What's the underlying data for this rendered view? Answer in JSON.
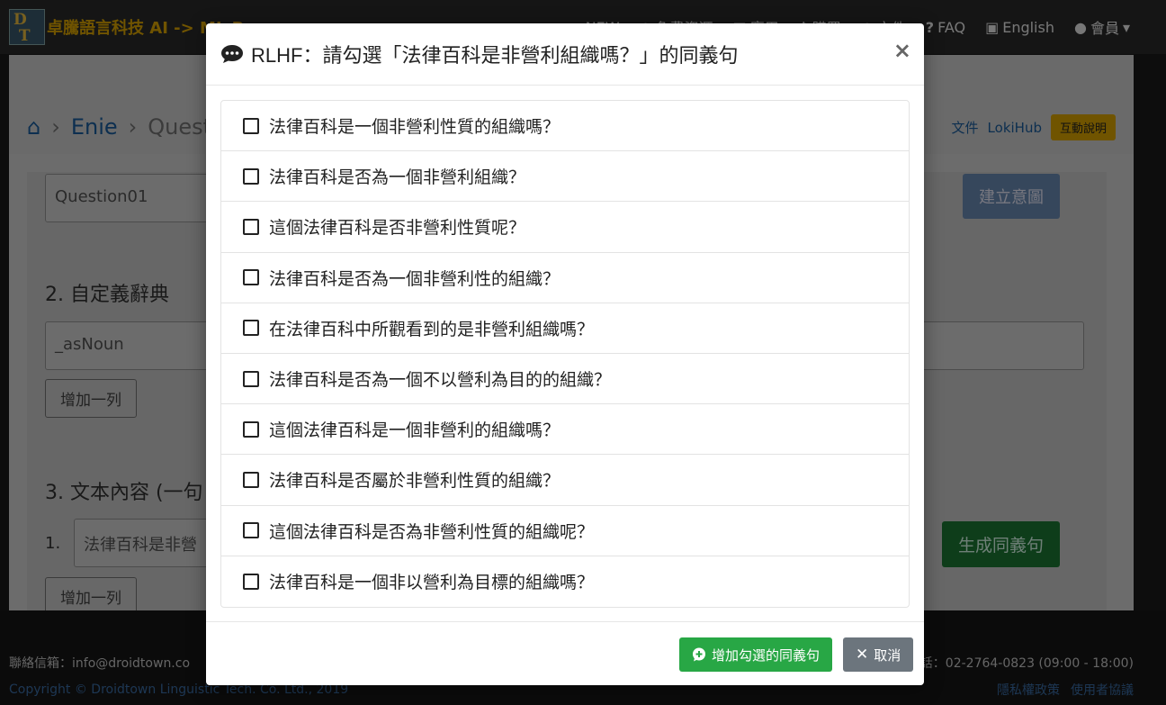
{
  "navbar": {
    "brand": "卓騰語言科技 AI -> ML B",
    "links": [
      "NEW",
      "免費資源",
      "應用",
      "購買",
      "文件",
      "FAQ",
      "English",
      "會員"
    ]
  },
  "background": {
    "breadcrumb": [
      "Enie",
      "Quest"
    ],
    "top_links": [
      "文件",
      "LokiHub",
      "互動說明"
    ],
    "intent_input": "Question01",
    "create_intent_button": "建立意圖",
    "section2": "2. 自定義辭典",
    "dict_input": "_asNoun",
    "add_row": "增加一列",
    "section3": "3. 文本內容 (一句",
    "row_number": "1.",
    "sentence_input": "法律百科是非營",
    "generate_button": "生成同義句",
    "add_row2": "增加一列"
  },
  "footer": {
    "mail": "聯絡信箱：info@droidtown.co",
    "copyright": "Copyright © Droidtown Linguistic Tech. Co. Ltd., 2019",
    "phone": "話：02-2764-0823 (09:00 - 18:00)",
    "privacy": "隱私權政策",
    "terms": "使用者協議"
  },
  "modal": {
    "title": "RLHF：請勾選「法律百科是非營利組織嗎？」的同義句",
    "close": "×",
    "options": [
      "法律百科是一個非營利性質的組織嗎？",
      "法律百科是否為一個非營利組織？",
      "這個法律百科是否非營利性質呢？",
      "法律百科是否為一個非營利性的組織？",
      "在法律百科中所觀看到的是非營利組織嗎？",
      "法律百科是否為一個不以營利為目的的組織？",
      "這個法律百科是一個非營利的組織嗎？",
      "法律百科是否屬於非營利性質的組織？",
      "這個法律百科是否為非營利性質的組織呢？",
      "法律百科是一個非以營利為目標的組織嗎？"
    ],
    "add_button": "增加勾選的同義句",
    "cancel_button": "取消"
  }
}
